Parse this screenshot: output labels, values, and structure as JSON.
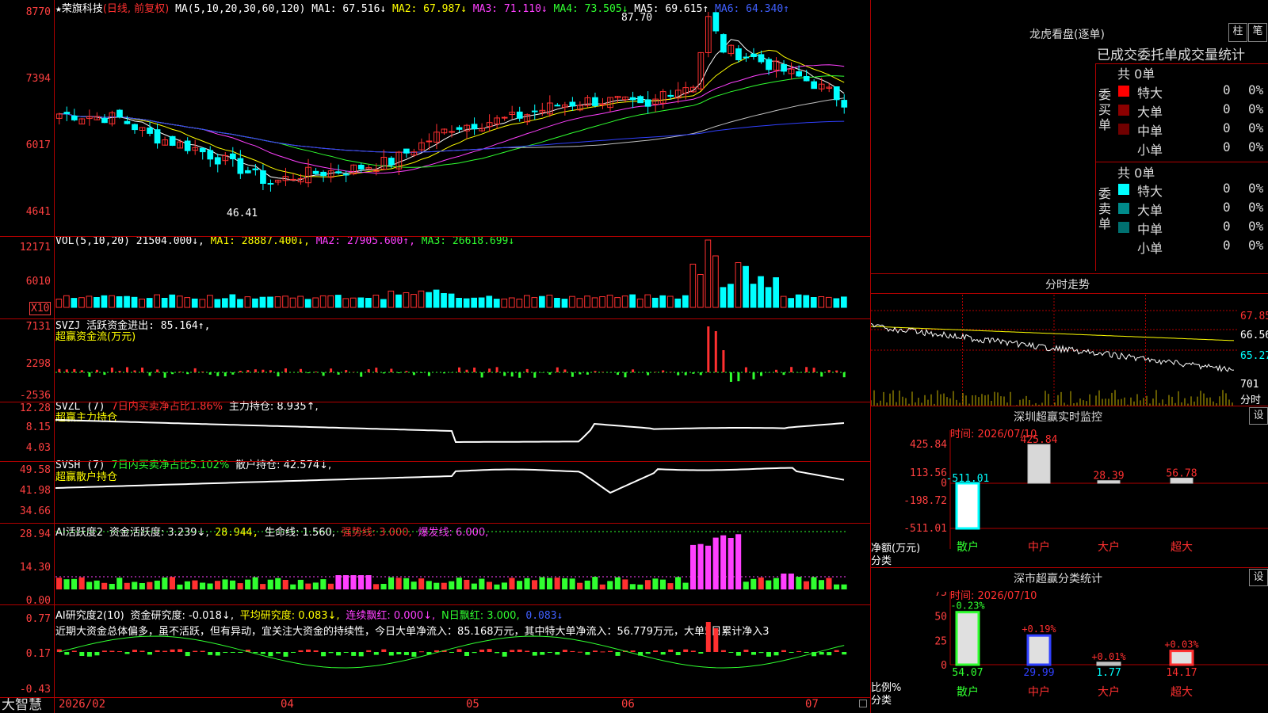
{
  "kline": {
    "star": "★",
    "stock": "荣旗科技",
    "period": "(日线, 前复权)",
    "ma_params": "MA(5,10,20,30,60,120)",
    "ma1": "MA1: 67.516↓",
    "ma2": "MA2: 67.987↓",
    "ma3": "MA3: 71.110↓",
    "ma4": "MA4: 73.505↓",
    "ma5": "MA5: 69.615↑",
    "ma6": "MA6: 64.340↑",
    "y_labels": [
      "8770",
      "7394",
      "6017",
      "4641"
    ],
    "high_label": "87.70",
    "low_label": "46.41"
  },
  "vol": {
    "title": "VOL(5,10,20)",
    "val": "21504.000↓,",
    "ma1": "MA1: 28887.400↓,",
    "ma2": "MA2: 27905.600↑,",
    "ma3": "MA3: 26618.699↓",
    "y_labels": [
      "12171",
      "6010"
    ],
    "unit": "X10"
  },
  "svzj": {
    "line1": "SVZJ  活跃资金进出: 85.164↑,",
    "line2": "超赢资金流(万元)",
    "y_labels": [
      "7131",
      "2298",
      "-2536"
    ]
  },
  "svzl": {
    "name": "SVZL (7)",
    "ratio": "7日内买卖净占比1.86%",
    "value": "主力持仓: 8.935↑,",
    "line2": "超赢主力持仓",
    "y_labels": [
      "12.28",
      "8.15",
      "4.03"
    ]
  },
  "svsh": {
    "name": "SVSH (7)",
    "ratio": "7日内买卖净占比5.102%",
    "value": "散户持仓: 42.574↓,",
    "line2": "超赢散户持仓",
    "y_labels": [
      "49.58",
      "41.98",
      "34.66"
    ]
  },
  "ai_active": {
    "name": "AI活跃度2",
    "v1": "资金活跃度: 3.239↓,",
    "v2": "28.944,",
    "v3": "生命线: 1.560,",
    "v4": "强势线: 3.000,",
    "v5": "爆发线: 6.000,",
    "y_labels": [
      "28.94",
      "14.30",
      "0.00"
    ]
  },
  "ai_research": {
    "name": "AI研究度2(10)",
    "v1": "资金研究度: -0.018↓,",
    "v2": "平均研究度: 0.083↓,",
    "v3": "连续飘红: 0.000↓,",
    "v4": "N日飘红: 3.000,",
    "v5": "0.083↓",
    "comment": "近期大资金总体偏多，虽不活跃，但有异动，宜关注大资金的持续性，今日大单净流入：85.168万元，其中特大单净流入：56.779万元，大单5日累计净入3",
    "y_labels": [
      "0.77",
      "0.17",
      "-0.43"
    ]
  },
  "bottom": {
    "brand": "大智慧",
    "months": [
      "2026/02",
      "04",
      "05",
      "06",
      "07"
    ]
  },
  "lhb": {
    "title": "龙虎看盘(逐单)",
    "btn1": "柱",
    "btn2": "笔",
    "subtitle": "已成交委托单成交量统计",
    "buy_label": "委买单",
    "sell_label": "委卖单",
    "buy_total": "共 0单",
    "sell_total": "共 0单",
    "buy_rows": [
      {
        "name": "特大",
        "count": "0",
        "pct": "0%",
        "color": "#ff0000"
      },
      {
        "name": "大单",
        "count": "0",
        "pct": "0%",
        "color": "#8b0000"
      },
      {
        "name": "中单",
        "count": "0",
        "pct": "0%",
        "color": "#700000"
      },
      {
        "name": "小单",
        "count": "0",
        "pct": "0%",
        "color": "#000000"
      }
    ],
    "sell_rows": [
      {
        "name": "特大",
        "count": "0",
        "pct": "0%",
        "color": "#00ffff"
      },
      {
        "name": "大单",
        "count": "0",
        "pct": "0%",
        "color": "#008b8b"
      },
      {
        "name": "中单",
        "count": "0",
        "pct": "0%",
        "color": "#007070"
      },
      {
        "name": "小单",
        "count": "0",
        "pct": "0%",
        "color": "#000000"
      }
    ]
  },
  "fenshi": {
    "title": "分时走势",
    "y_labels": [
      "67.85",
      "66.56",
      "65.27",
      "701"
    ],
    "unit": "分时"
  },
  "monitor": {
    "title": "深圳超赢实时监控",
    "btn": "设",
    "time": "时间: 2026/07/10",
    "y_labels": [
      "425.84",
      "113.56",
      "0",
      "-198.72",
      "-511.01"
    ],
    "unit_label": "净额(万元)",
    "class_label": "分类",
    "cats": [
      "散户",
      "中户",
      "大户",
      "超大"
    ],
    "values": [
      -511.01,
      425.84,
      28.39,
      56.78
    ],
    "value_labels": [
      "-511.01",
      "425.84",
      "28.39",
      "56.78"
    ]
  },
  "classify": {
    "title": "深市超赢分类统计",
    "btn": "设",
    "time": "时间: 2026/07/10",
    "y_labels": [
      "75",
      "50",
      "25",
      "0"
    ],
    "unit_label": "比例%",
    "class_label": "分类",
    "cats": [
      "散户",
      "中户",
      "大户",
      "超大"
    ],
    "values": [
      54.07,
      29.99,
      1.77,
      14.17
    ],
    "value_labels": [
      "54.07",
      "29.99",
      "1.77",
      "14.17"
    ],
    "change_labels": [
      "-0.23%",
      "+0.19%",
      "+0.01%",
      "+0.03%"
    ]
  }
}
